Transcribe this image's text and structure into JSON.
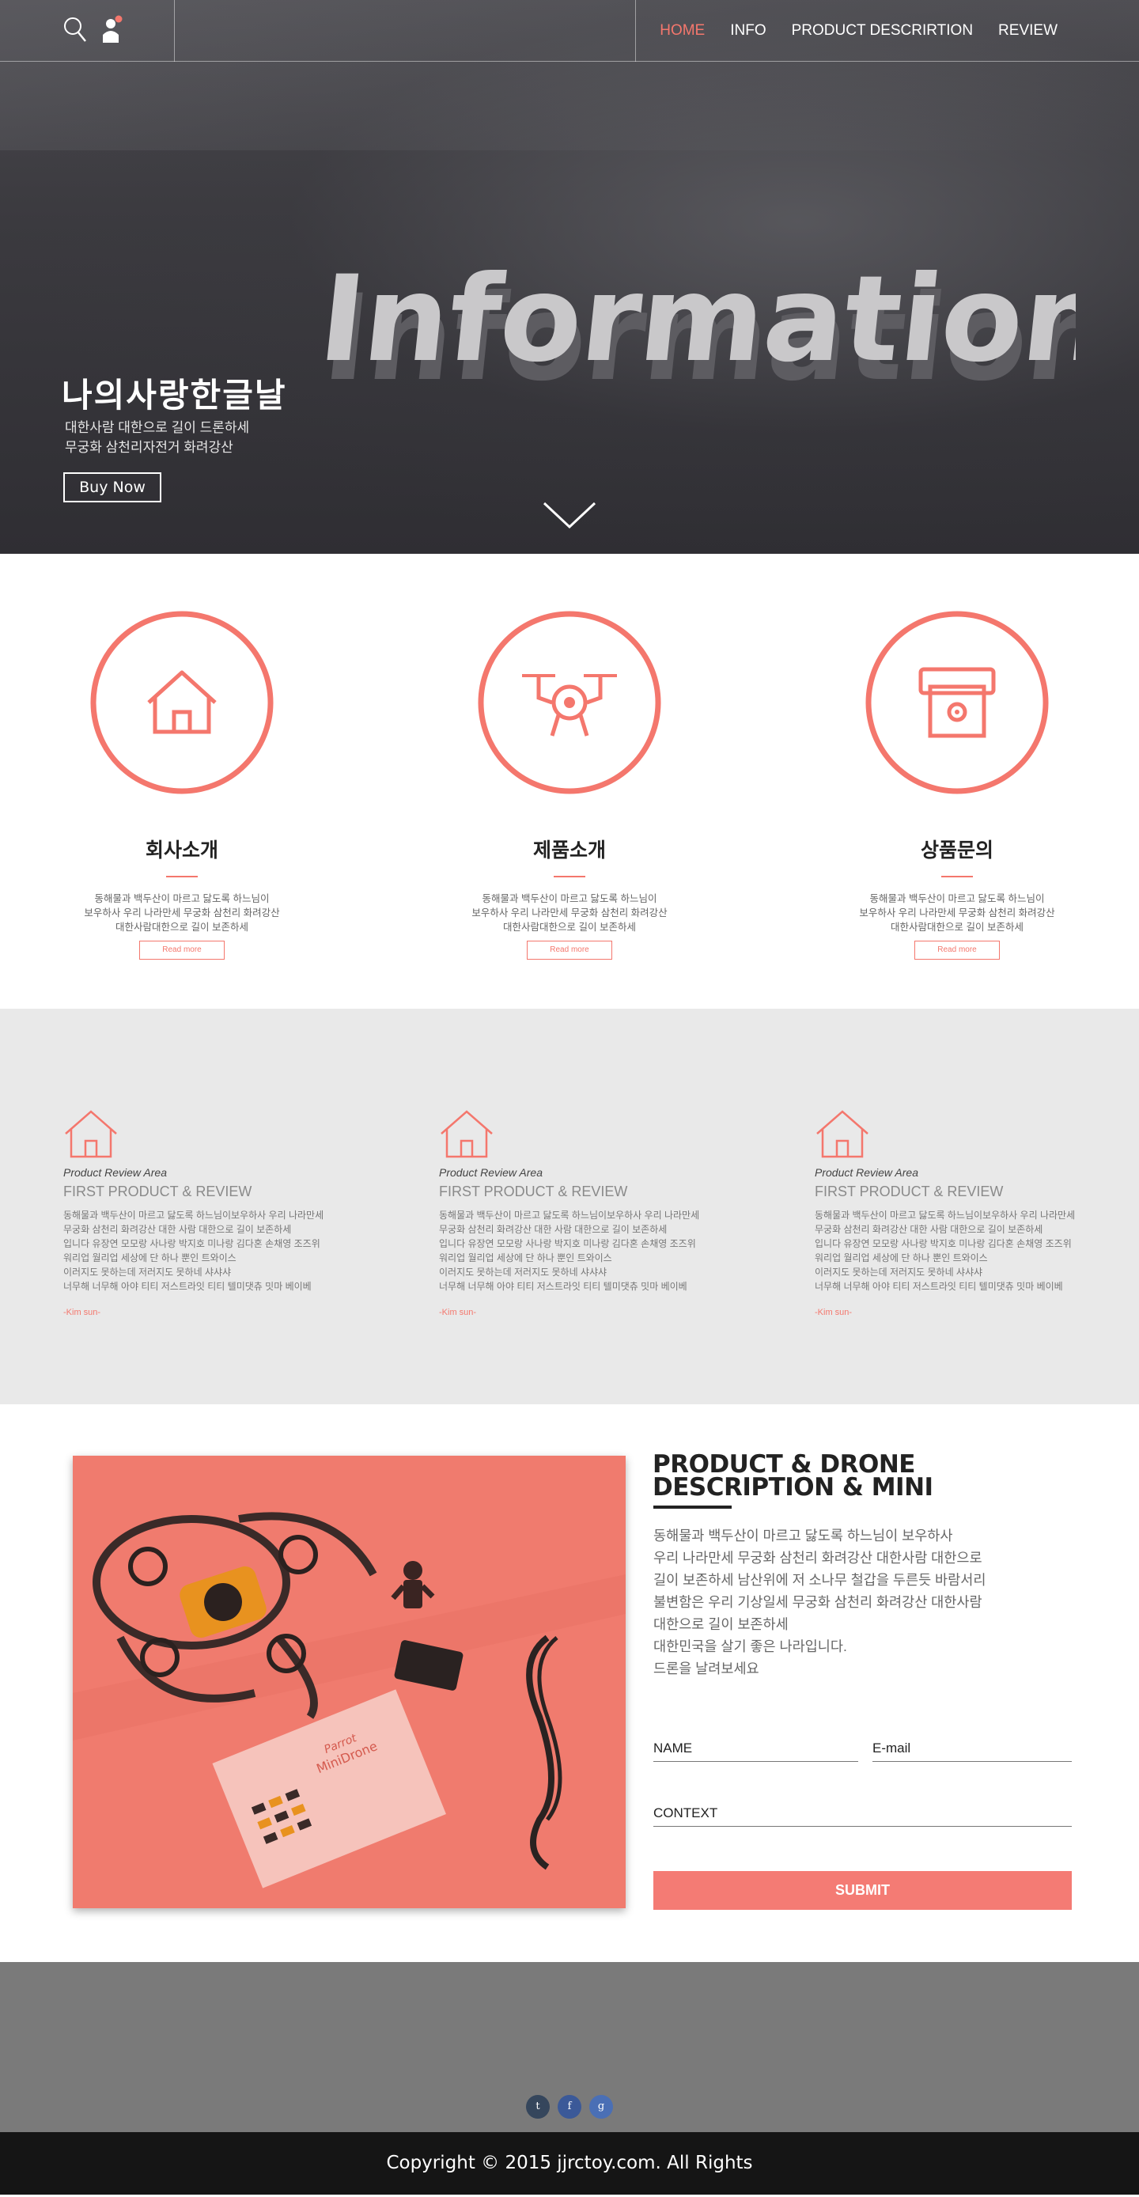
{
  "colors": {
    "accent": "#f4776d",
    "hero_bg": "#3b3a3f",
    "review_bg": "#e9e9e9",
    "footer_bg": "#7a7a7a",
    "copyright_bg": "#151515"
  },
  "nav": {
    "items": [
      {
        "label": "HOME",
        "active": true
      },
      {
        "label": "INFO",
        "active": false
      },
      {
        "label": "PRODUCT DESCRIRTION",
        "active": false
      },
      {
        "label": "REVIEW",
        "active": false
      }
    ],
    "icons": [
      "search-icon",
      "user-icon"
    ]
  },
  "hero": {
    "background_word": "Information",
    "title": "나의사랑한글날",
    "subtitle_line1": "대한사람 대한으로 길이 드론하세",
    "subtitle_line2": "무궁화 삼천리자전거 화려강산",
    "button_label": "Buy  Now",
    "scroll_icon": "chevron-down-icon"
  },
  "features": [
    {
      "icon": "house-icon",
      "title": "회사소개",
      "line1": "동해물과 백두산이 마르고 닳도록 하느님이",
      "line2": "보우하사 우리 나라만세 무궁화 삼천리 화려강산",
      "line3": "대한사람대한으로 길이 보존하세",
      "button": "Read more"
    },
    {
      "icon": "drone-icon",
      "title": "제품소개",
      "line1": "동해물과 백두산이 마르고 닳도록 하느님이",
      "line2": "보우하사 우리 나라만세 무궁화 삼천리 화려강산",
      "line3": "대한사람대한으로 길이 보존하세",
      "button": "Read more"
    },
    {
      "icon": "printer-icon",
      "title": "상품문의",
      "line1": "동해물과 백두산이 마르고 닳도록 하느님이",
      "line2": "보우하사 우리 나라만세 무궁화 삼천리 화려강산",
      "line3": "대한사람대한으로 길이 보존하세",
      "button": "Read more"
    }
  ],
  "reviews": [
    {
      "tag": "Product Review Area",
      "title": "FIRST PRODUCT & REVIEW",
      "lines": [
        "동해물과 백두산이 마르고 닳도록 하느님이보우하사 우리 나라만세",
        "무궁화 삼천리 화려강산 대한 사람 대한으로 길이 보존하세",
        "입니다 유장연 모모랑 사나랑 박지호 미나랑 김다혼 손채영 조즈위",
        "워리업 월리업 세상에 단 하나 뿐인 트와이스",
        "이러지도 못하는데 저러지도 못하네 샤샤샤",
        "너무해 너무해 아야 티티 저스트라잇 티티 텔미댓츄 밋마 베이베"
      ],
      "author": "-Kim sun-"
    },
    {
      "tag": "Product Review Area",
      "title": "FIRST PRODUCT & REVIEW",
      "lines": [
        "동해물과 백두산이 마르고 닳도록 하느님이보우하사 우리 나라만세",
        "무궁화 삼천리 화려강산 대한 사람 대한으로 길이 보존하세",
        "입니다 유장연 모모랑 사나랑 박지호 미나랑 김다혼 손채영 조즈위",
        "워리업 월리업 세상에 단 하나 뿐인 트와이스",
        "이러지도 못하는데 저러지도 못하네 샤샤샤",
        "너무해 너무해 아야 티티 저스트라잇 티티 텔미댓츄 밋마 베이베"
      ],
      "author": "-Kim sun-"
    },
    {
      "tag": "Product Review Area",
      "title": "FIRST PRODUCT & REVIEW",
      "lines": [
        "동해물과 백두산이 마르고 닳도록 하느님이보우하사 우리 나라만세",
        "무궁화 삼천리 화려강산 대한 사람 대한으로 길이 보존하세",
        "입니다 유장연 모모랑 사나랑 박지호 미나랑 김다혼 손채영 조즈위",
        "워리업 월리업 세상에 단 하나 뿐인 트와이스",
        "이러지도 못하는데 저러지도 못하네 샤샤샤",
        "너무해 너무해 아야 티티 저스트라잇 티티 텔미댓츄 밋마 베이베"
      ],
      "author": "-Kim sun-"
    }
  ],
  "product": {
    "title_line1": "PRODUCT & DRONE",
    "title_line2": "DESCRIPTION & MINI",
    "body": [
      "동해물과 백두산이 마르고 닳도록 하느님이 보우하사",
      "우리 나라만세 무궁화 삼천리 화려강산 대한사람 대한으로",
      "길이 보존하세 남산위에 저  소나무 철갑을 두른듯 바람서리",
      "불변함은 우리 기상일세 무궁화 삼천리 화려강산 대한사람",
      "대한으로 길이 보존하세",
      "대한민국을 살기 좋은 나라입니다.",
      "드론을 날려보세요"
    ],
    "image_label_1": "Parrot",
    "image_label_2": "MiniDrone"
  },
  "form": {
    "name_placeholder": "NAME",
    "email_placeholder": "E-mail",
    "context_placeholder": "CONTEXT",
    "submit_label": "SUBMIT"
  },
  "footer": {
    "social": [
      {
        "icon": "tumblr-icon",
        "glyph": "t",
        "color": "#35465c"
      },
      {
        "icon": "facebook-icon",
        "glyph": "f",
        "color": "#3b5998"
      },
      {
        "icon": "google-icon",
        "glyph": "g",
        "color": "#4a6fb5"
      }
    ],
    "copyright": "Copyright © 2015 jjrctoy.com. All Rights"
  }
}
